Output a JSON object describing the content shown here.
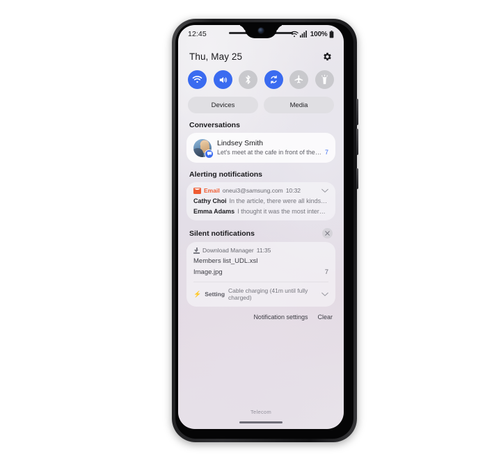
{
  "status_bar": {
    "clock": "12:45",
    "battery_text": "100%",
    "wifi_icon": "wifi-icon",
    "signal_icon": "signal-bars-icon",
    "battery_icon": "battery-full-icon"
  },
  "header": {
    "date": "Thu, May 25",
    "settings_icon": "gear-icon"
  },
  "toggles": [
    {
      "name": "wifi",
      "icon": "wifi-icon",
      "state": "on"
    },
    {
      "name": "sound",
      "icon": "speaker-icon",
      "state": "on"
    },
    {
      "name": "bluetooth",
      "icon": "bluetooth-icon",
      "state": "off"
    },
    {
      "name": "auto-rotate",
      "icon": "auto-rotate-icon",
      "state": "on"
    },
    {
      "name": "airplane",
      "icon": "airplane-icon",
      "state": "off"
    },
    {
      "name": "flashlight",
      "icon": "flashlight-icon",
      "state": "off"
    }
  ],
  "pills": {
    "devices": "Devices",
    "media": "Media"
  },
  "conversations": {
    "label": "Conversations",
    "item": {
      "name": "Lindsey Smith",
      "message": "Let's meet at the cafe in front of the coff...",
      "count": "7",
      "avatar_icon": "contact-photo-avatar",
      "badge_icon": "message-bubble-icon"
    }
  },
  "alerting": {
    "label": "Alerting notifications",
    "app": {
      "icon": "email-icon",
      "name": "Email",
      "account": "oneui3@samsung.com",
      "time": "10:32",
      "expand_icon": "chevron-down-icon"
    },
    "messages": [
      {
        "sender": "Cathy Choi",
        "body": "In the article, there were all kinds of wond..."
      },
      {
        "sender": "Emma Adams",
        "body": "I thought it was the most interesting th..."
      }
    ]
  },
  "silent": {
    "label": "Silent notifications",
    "close_icon": "close-icon",
    "download": {
      "icon": "download-icon",
      "app": "Download Manager",
      "time": "11:35",
      "files": [
        {
          "name": "Members list_UDL.xsl",
          "count": ""
        },
        {
          "name": "Image.jpg",
          "count": "7"
        }
      ]
    },
    "setting": {
      "icon": "lightning-bolt-icon",
      "label": "Setting",
      "text": "Cable charging (41m until fully charged)",
      "expand_icon": "chevron-down-icon"
    }
  },
  "actions": {
    "notification_settings": "Notification settings",
    "clear": "Clear"
  },
  "footer": {
    "carrier": "Telecom"
  },
  "colors": {
    "accent_blue": "#3a6bf0",
    "toggle_off": "#c9c9cd",
    "email_orange": "#ee5b32"
  }
}
